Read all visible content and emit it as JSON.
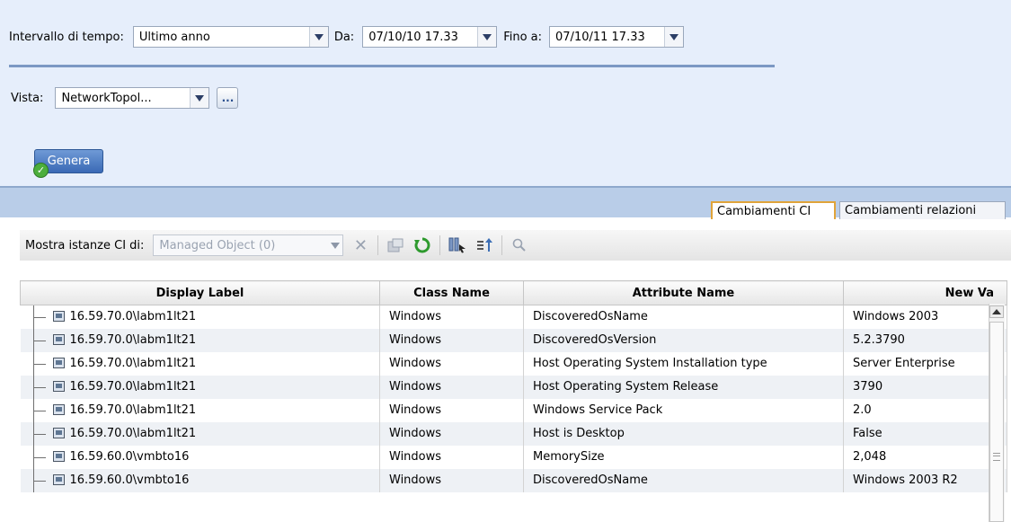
{
  "filters": {
    "interval_label": "Intervallo di tempo:",
    "interval_value": "Ultimo anno",
    "from_label": "Da:",
    "from_value": "07/10/10 17.33",
    "to_label": "Fino a:",
    "to_value": "07/10/11 17.33",
    "view_label": "Vista:",
    "view_value": "NetworkTopol...",
    "dots_label": "...",
    "generate_label": "Genera"
  },
  "tabs": [
    {
      "label": "Cambiamenti CI",
      "active": true
    },
    {
      "label": "Cambiamenti relazioni",
      "active": false
    }
  ],
  "toolbar": {
    "show_label": "Mostra istanze CI di:",
    "show_value": "Managed Object (0)"
  },
  "table": {
    "columns": [
      "Display Label",
      "Class Name",
      "Attribute Name",
      "New Va"
    ],
    "rows": [
      [
        "16.59.70.0\\labm1lt21",
        "Windows",
        "DiscoveredOsName",
        "Windows 2003"
      ],
      [
        "16.59.70.0\\labm1lt21",
        "Windows",
        "DiscoveredOsVersion",
        "5.2.3790"
      ],
      [
        "16.59.70.0\\labm1lt21",
        "Windows",
        "Host Operating System Installation type",
        "Server Enterprise"
      ],
      [
        "16.59.70.0\\labm1lt21",
        "Windows",
        "Host Operating System Release",
        "3790"
      ],
      [
        "16.59.70.0\\labm1lt21",
        "Windows",
        "Windows Service Pack",
        "2.0"
      ],
      [
        "16.59.70.0\\labm1lt21",
        "Windows",
        "Host is Desktop",
        "False"
      ],
      [
        "16.59.60.0\\vmbto16",
        "Windows",
        "MemorySize",
        "2,048"
      ],
      [
        "16.59.60.0\\vmbto16",
        "Windows",
        "DiscoveredOsName",
        "Windows 2003 R2"
      ]
    ]
  },
  "colors": {
    "panel_bg": "#e6eefb",
    "band_bg": "#b9cde8",
    "accent_blue": "#3a69b5",
    "active_tab_border": "#e0a43a"
  }
}
